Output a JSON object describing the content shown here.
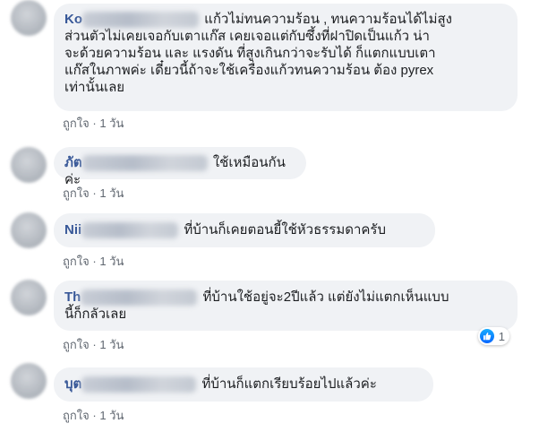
{
  "comments": [
    {
      "name_visible": "Ko",
      "text_lines": [
        "แก้วไม่ทนความร้อน , ทนความร้อนได้ไม่สูง",
        "ส่วนตัวไม่เคยเจอกับเตาแก๊ส เคยเจอแต่กับซึ้งที่ฝาปิดเป็นแก้ว น่า",
        "จะด้วยความร้อน และ แรงดัน ที่สูงเกินกว่าจะรับได้ ก็แตกแบบเตา",
        "แก๊สในภาพค่ะ เดี๋ยวนี้ถ้าจะใช้เครื่องแก้วทนความร้อน ต้อง pyrex",
        "เท่านั้นเลย"
      ],
      "like": "ถูกใจ",
      "dot": "·",
      "time": "1 วัน"
    },
    {
      "name_visible": "ภัต",
      "text_lines": [
        "ใช้เหมือนกันค่ะ"
      ],
      "like": "ถูกใจ",
      "dot": "·",
      "time": "1 วัน"
    },
    {
      "name_visible": "Nii",
      "text_lines": [
        "ที่บ้านก็เคยตอนยี้ใช้หัวธรรมดาครับ"
      ],
      "like": "ถูกใจ",
      "dot": "·",
      "time": "1 วัน"
    },
    {
      "name_visible": "Th",
      "text_lines": [
        "ที่บ้านใช้อยู่จะ2ปีแล้ว แต่ยังไม่แตกเห็นแบบ",
        "นี้ก็กลัวเลย"
      ],
      "like": "ถูกใจ",
      "dot": "·",
      "time": "1 วัน",
      "reaction_count": "1"
    },
    {
      "name_visible": "บุต",
      "text_lines": [
        "ที่บ้านก็แตกเรียบร้อยไปแล้วค่ะ"
      ],
      "like": "ถูกใจ",
      "dot": "·",
      "time": "1 วัน"
    }
  ],
  "colors": {
    "bubble": "#f0f2f5",
    "name": "#385898",
    "meta": "#606770",
    "like_badge": "#0866ff"
  }
}
